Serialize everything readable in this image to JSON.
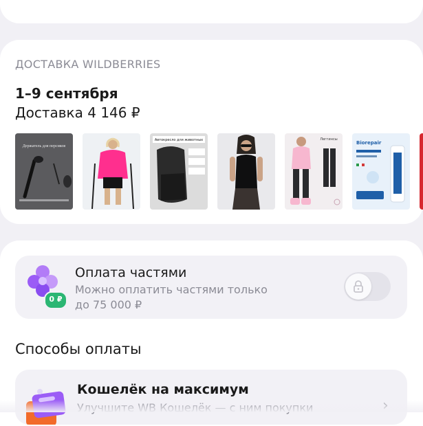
{
  "top": {
    "peek_text": "· · ·"
  },
  "delivery": {
    "section_label": "ДОСТАВКА WILDBERRIES",
    "date": "1–9 сентября",
    "cost": "Доставка 4 146 ₽",
    "items": [
      {
        "icon": "product-phone-holder",
        "text": "Держатель для персиков"
      },
      {
        "icon": "product-pink-jacket",
        "text": ""
      },
      {
        "icon": "product-pet-car-seat",
        "text": "Автокресло для животных"
      },
      {
        "icon": "product-black-top",
        "text": ""
      },
      {
        "icon": "product-leggings",
        "text": "Леггинсы"
      },
      {
        "icon": "product-toothpaste",
        "text": "Biorepair"
      }
    ]
  },
  "installments": {
    "title": "Оплата частями",
    "subtitle_line1": "Можно оплатить частями только",
    "subtitle_line2": "до 75 000 ₽",
    "badge": "0 ₽",
    "toggle_state": "off-locked"
  },
  "payment_methods": {
    "title": "Способы оплаты",
    "wallet_title": "Кошелёк на максимум",
    "wallet_subtitle": "Улучшите WB Кошелёк — с ним покупки"
  },
  "colors": {
    "background": "#f1f0f5",
    "card": "#ffffff",
    "accent_purple": "#9b5cf6",
    "badge_green": "#2bb673"
  }
}
